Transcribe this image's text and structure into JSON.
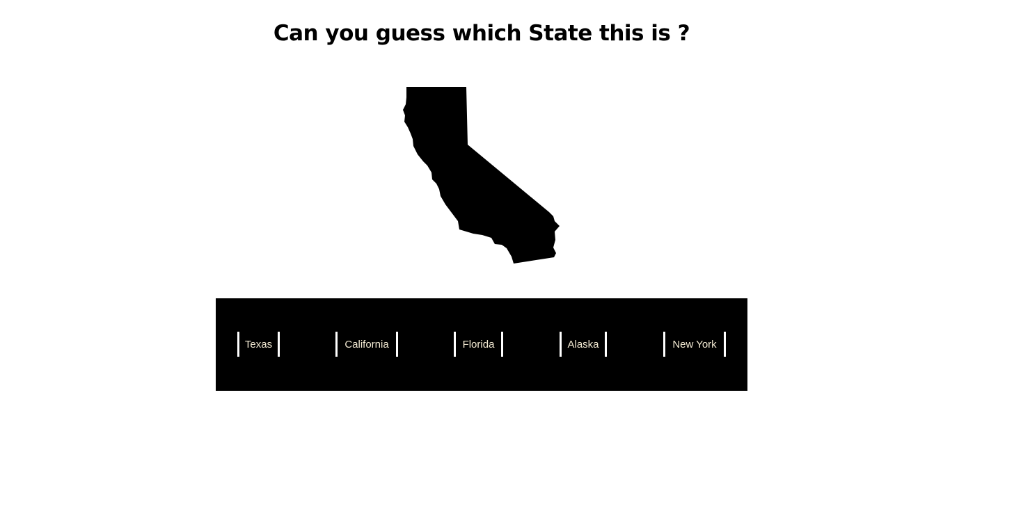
{
  "header": {
    "title": "Can you guess which State this is ?"
  },
  "state_image": {
    "icon": "california-silhouette",
    "color": "#000000"
  },
  "answers": {
    "options": [
      {
        "label": "Texas"
      },
      {
        "label": "California"
      },
      {
        "label": "Florida"
      },
      {
        "label": "Alaska"
      },
      {
        "label": "New York"
      }
    ],
    "panel_color": "#000000",
    "text_color": "#f3ead3"
  }
}
